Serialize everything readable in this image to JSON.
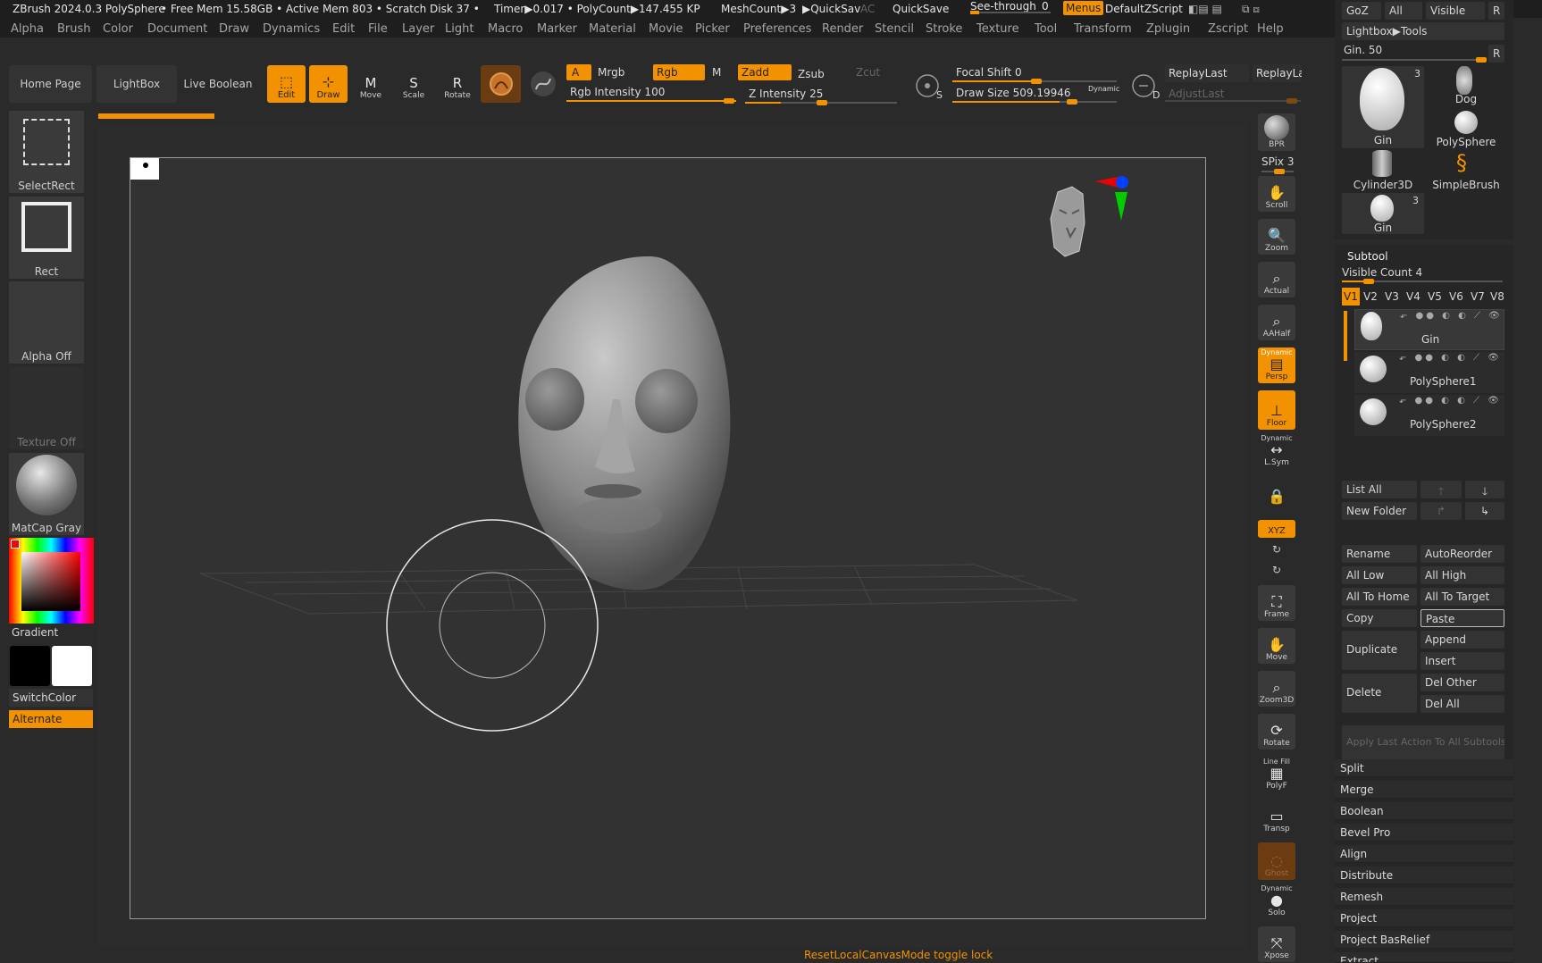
{
  "title_bar": {
    "app": "ZBrush 2024.0.3 PolySphere",
    "free_mem": "• Free Mem 15.58GB • Active Mem 803 • Scratch Disk 37 •",
    "timer": "Timer▶0.017 • PolyCount▶147.455 KP",
    "meshcount": "MeshCount▶3",
    "quicksave_short": "▶QuickSav",
    "ac": "AC",
    "quicksave": "QuickSave",
    "see_through": "See-through",
    "see_through_value": "0",
    "menus": "Menus",
    "default_zscript": "DefaultZScript"
  },
  "menu": [
    "Alpha",
    "Brush",
    "Color",
    "Document",
    "Draw",
    "Dynamics",
    "Edit",
    "File",
    "Layer",
    "Light",
    "Macro",
    "Marker",
    "Material",
    "Movie",
    "Picker",
    "Preferences",
    "Render",
    "Stencil",
    "Stroke",
    "Texture",
    "Tool",
    "Transform",
    "Zplugin",
    "Zscript",
    "Help"
  ],
  "toolbar": {
    "home_page": "Home Page",
    "lightbox": "LightBox",
    "live_boolean": "Live Boolean",
    "edit": "Edit",
    "draw": "Draw",
    "move": "Move",
    "scale": "Scale",
    "rotate": "Rotate",
    "a": "A",
    "mrgb": "Mrgb",
    "rgb": "Rgb",
    "m": "M",
    "zadd": "Zadd",
    "zsub": "Zsub",
    "zcut": "Zcut",
    "rgb_intensity": "Rgb Intensity 100",
    "z_intensity": "Z Intensity 25",
    "focal_shift": "Focal Shift 0",
    "draw_size": "Draw Size 509.19946",
    "dynamic": "Dynamic",
    "replay_last": "ReplayLast",
    "replay_last2": "ReplayLa",
    "adjust_last": "AdjustLast",
    "s_label": "S",
    "d_label": "D"
  },
  "left_shelf": {
    "select_rect": "SelectRect",
    "rect": "Rect",
    "alpha_off": "Alpha Off",
    "texture_off": "Texture Off",
    "matcap": "MatCap Gray",
    "gradient": "Gradient",
    "switch_color": "SwitchColor",
    "alternate": "Alternate"
  },
  "right_shelf": {
    "bpr": "BPR",
    "spix": "SPix 3",
    "scroll": "Scroll",
    "zoom": "Zoom",
    "actual": "Actual",
    "aahalf": "AAHalf",
    "dynamic": "Dynamic",
    "persp": "Persp",
    "floor": "Floor",
    "lsym": "L.Sym",
    "xyz": "XYZ",
    "frame": "Frame",
    "move": "Move",
    "zoom3d": "Zoom3D",
    "rotate": "Rotate",
    "line_fill": "Line Fill",
    "polyf": "PolyF",
    "transp": "Transp",
    "ghost": "Ghost",
    "solo": "Solo",
    "xpose": "Xpose"
  },
  "tool_palette": {
    "goz": "GoZ",
    "all": "All",
    "visible": "Visible",
    "r": "R",
    "lightbox_tools": "Lightbox▶Tools",
    "gin_slider": "Gin. 50",
    "thumbs": [
      {
        "name": "Gin",
        "count": "3"
      },
      {
        "name": "Dog",
        "count": ""
      },
      {
        "name": "PolySphere",
        "count": ""
      },
      {
        "name": "Cylinder3D",
        "count": ""
      },
      {
        "name": "SimpleBrush",
        "count": ""
      },
      {
        "name": "Gin",
        "count": "3"
      }
    ]
  },
  "subtool": {
    "header": "Subtool",
    "visible_count": "Visible Count 4",
    "versions": [
      "V1",
      "V2",
      "V3",
      "V4",
      "V5",
      "V6",
      "V7",
      "V8"
    ],
    "items": [
      "Gin",
      "PolySphere1",
      "PolySphere2"
    ],
    "list_all": "List All",
    "new_folder": "New Folder",
    "rename": "Rename",
    "auto_reorder": "AutoReorder",
    "all_low": "All Low",
    "all_high": "All High",
    "all_to_home": "All To Home",
    "all_to_target": "All To Target",
    "copy": "Copy",
    "paste": "Paste",
    "duplicate": "Duplicate",
    "append": "Append",
    "insert": "Insert",
    "delete": "Delete",
    "del_other": "Del Other",
    "del_all": "Del All",
    "apply_last": "Apply Last Action To All Subtools",
    "sections": [
      "Split",
      "Merge",
      "Boolean",
      "Bevel Pro",
      "Align",
      "Distribute",
      "Remesh",
      "Project",
      "Project BasRelief",
      "Extract"
    ]
  },
  "bottom": {
    "status": "ResetLocalCanvasMode toggle lock"
  }
}
